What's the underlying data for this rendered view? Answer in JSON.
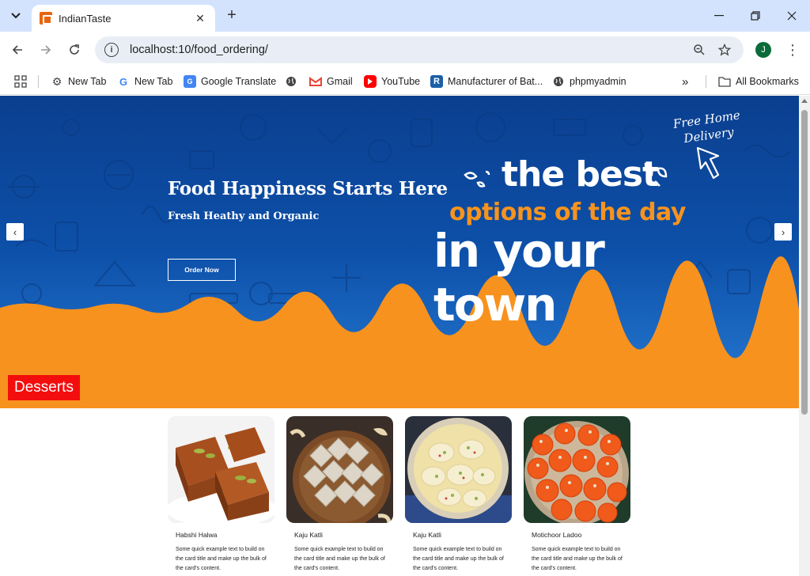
{
  "browser": {
    "tab_title": "IndianTaste",
    "url": "localhost:10/food_ordering/",
    "profile_initial": "J",
    "bookmarks": [
      {
        "label": "New Tab",
        "icon": "gear-icon"
      },
      {
        "label": "New Tab",
        "icon": "google-icon"
      },
      {
        "label": "Google Translate",
        "icon": "translate-icon"
      },
      {
        "label": "",
        "icon": "globe-icon"
      },
      {
        "label": "Gmail",
        "icon": "gmail-icon"
      },
      {
        "label": "YouTube",
        "icon": "youtube-icon"
      },
      {
        "label": "Manufacturer of Bat...",
        "icon": "r-icon"
      },
      {
        "label": "phpmyadmin",
        "icon": "globe-icon"
      }
    ],
    "all_bookmarks": "All Bookmarks"
  },
  "hero": {
    "title": "Food Happiness Starts Here",
    "subtitle": "Fresh Heathy and Organic",
    "button": "Order Now",
    "promo_line1": "the best",
    "promo_line2": "options of the day",
    "promo_line3": "in your town",
    "free_delivery_line1": "Free Home",
    "free_delivery_line2": "Delivery",
    "prev": "‹",
    "next": "›"
  },
  "section": {
    "title": "Desserts"
  },
  "cards": [
    {
      "title": "Habshi Halwa",
      "text": "Some quick example text to build on the card title and make up the bulk of the card's content."
    },
    {
      "title": "Kaju Katli",
      "text": "Some quick example text to build on the card title and make up the bulk of the card's content."
    },
    {
      "title": "Kaju Katli",
      "text": "Some quick example text to build on the card title and make up the bulk of the card's content."
    },
    {
      "title": "Motichoor Ladoo",
      "text": "Some quick example text to build on the card title and make up the bulk of the card's content."
    }
  ],
  "colors": {
    "hero_blue": "#0d50a9",
    "accent_orange": "#f8921e",
    "section_red": "#f40d0d"
  }
}
